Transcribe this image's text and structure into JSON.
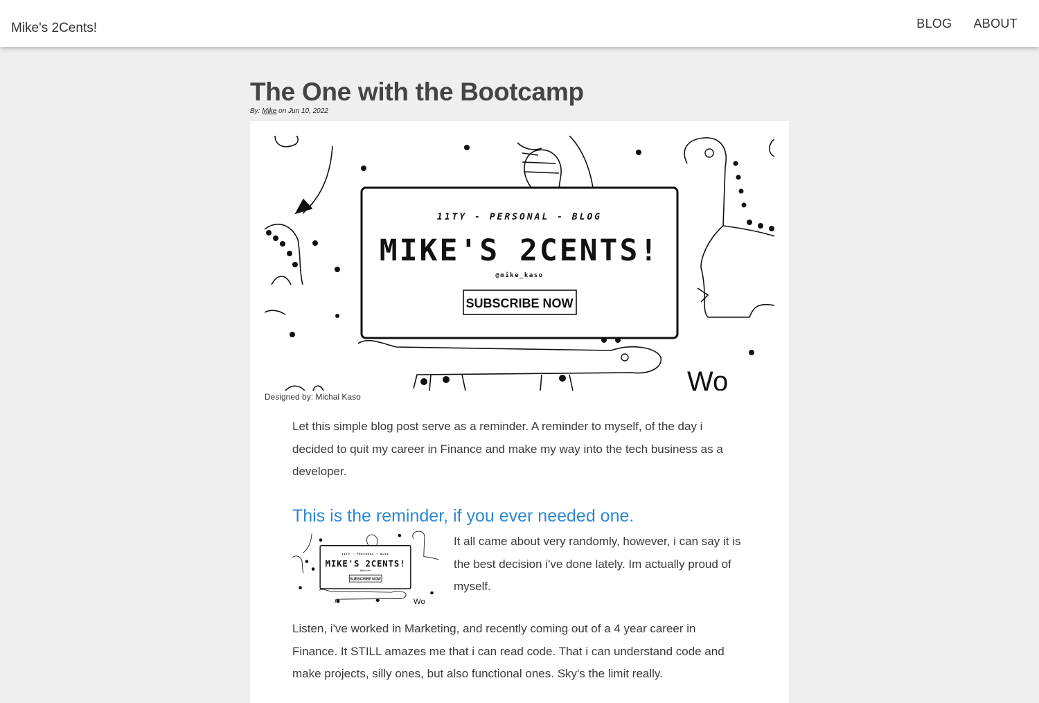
{
  "nav": {
    "brand": "Mike's 2Cents!",
    "links": [
      "BLOG",
      "ABOUT"
    ]
  },
  "post": {
    "title": "The One with the Bootcamp",
    "byline_prefix": "By:",
    "author": "Mike",
    "byline_date": "on Jun 10, 2022"
  },
  "hero": {
    "tagline": "11TY - PERSONAL - BLOG",
    "title": "MIKE'S 2CENTS!",
    "handle": "@mike_kaso",
    "cta": "SUBSCRIBE NOW",
    "corner_text": "Wo",
    "caption": "Designed by: Michal Kaso"
  },
  "content": {
    "intro": "Let this simple blog post serve as a reminder. A reminder to myself, of the day i decided to quit my career in Finance and make my way into the tech business as a developer.",
    "subheading": "This is the reminder, if you ever needed one.",
    "para2": "It all came about very randomly, however, i can say it is the best decision i've done lately. Im actually proud of myself.",
    "para3": "Listen, i've worked in Marketing, and recently coming out of a 4 year career in Finance. It STILL amazes me that i can read code. That i can understand code and make projects, silly ones, but also functional ones. Sky's the limit really."
  },
  "colors": {
    "background": "#efefef",
    "card": "#ffffff",
    "accent": "#2d88d0",
    "text": "#333333"
  }
}
